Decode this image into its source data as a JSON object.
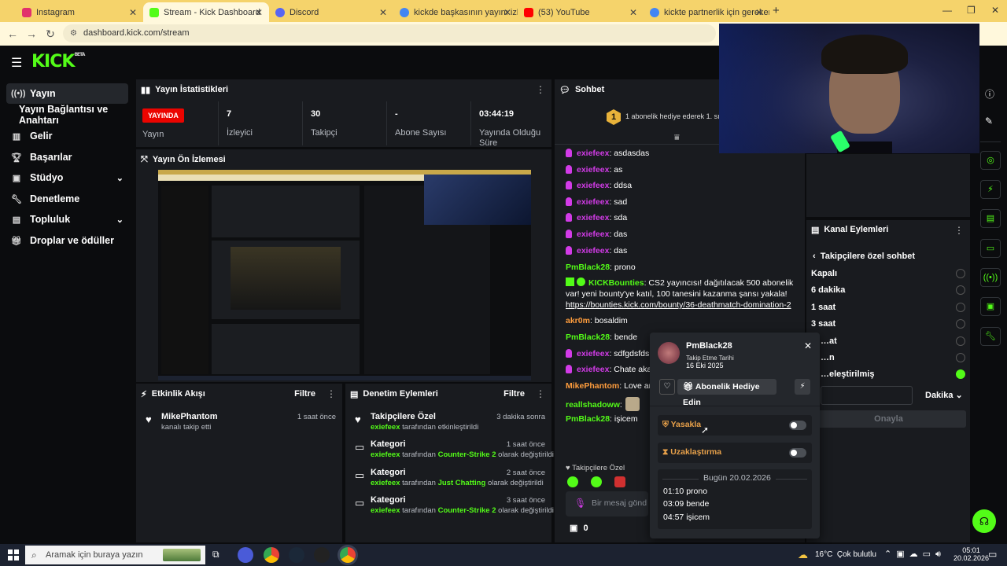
{
  "browser": {
    "tabs": [
      {
        "label": "Instagram",
        "color": "#e1306c"
      },
      {
        "label": "Stream - Kick Dashboard",
        "color": "#53fc18"
      },
      {
        "label": "Discord",
        "color": "#5865f2"
      },
      {
        "label": "kickde başkasının yayını izleme",
        "color": "#4285f4"
      },
      {
        "label": "(53) YouTube",
        "color": "#ff0000"
      },
      {
        "label": "kickte partnerlik için gerekenle",
        "color": "#4285f4"
      }
    ],
    "new_tab": "+",
    "url": "dashboard.kick.com/stream"
  },
  "header": {
    "logo": "KICK",
    "beta": "BETA"
  },
  "sidebar": {
    "items": [
      {
        "label": "Yayın",
        "icon": "broadcast-icon"
      },
      {
        "label": "Yayın Bağlantısı ve Anahtarı",
        "icon": ""
      },
      {
        "label": "Gelir",
        "icon": "chart-icon"
      },
      {
        "label": "Başarılar",
        "icon": "trophy-icon"
      },
      {
        "label": "Stüdyo",
        "icon": "studio-icon"
      },
      {
        "label": "Denetleme",
        "icon": "wrench-icon"
      },
      {
        "label": "Topluluk",
        "icon": "community-icon"
      },
      {
        "label": "Droplar ve ödüller",
        "icon": "gift-icon"
      }
    ]
  },
  "stats": {
    "title": "Yayın İstatistikleri",
    "live_badge": "YAYINDA",
    "live_label": "Yayın",
    "viewers_value": "7",
    "viewers_label": "İzleyici",
    "followers_value": "30",
    "followers_label": "Takipçi",
    "subs_value": "-",
    "subs_label": "Abone Sayısı",
    "uptime_value": "03:44:19",
    "uptime_label1": "Yayında Olduğu",
    "uptime_label2": "Süre"
  },
  "preview": {
    "title": "Yayın Ön İzlemesi"
  },
  "activity": {
    "title": "Etkinlik Akışı",
    "filter": "Filtre",
    "items": [
      {
        "name": "MikePhantom",
        "desc": "kanalı takip etti",
        "time": "1 saat önce"
      }
    ]
  },
  "moderation": {
    "title": "Denetim Eylemleri",
    "filter": "Filtre",
    "items": [
      {
        "title": "Takipçilere Özel",
        "user": "exiefeex",
        "pre": "tarafından etkinleştirildi",
        "target": "",
        "post": "",
        "time": "3 dakika sonra"
      },
      {
        "title": "Kategori",
        "user": "exiefeex",
        "pre": "tarafından",
        "target": "Counter-Strike 2",
        "post": "olarak değiştirildi",
        "time": "1 saat önce"
      },
      {
        "title": "Kategori",
        "user": "exiefeex",
        "pre": "tarafından",
        "target": "Just Chatting",
        "post": "olarak değiştirildi",
        "time": "2 saat önce"
      },
      {
        "title": "Kategori",
        "user": "exiefeex",
        "pre": "tarafından",
        "target": "Counter-Strike 2",
        "post": "olarak değiştirildi",
        "time": "3 saat önce"
      }
    ]
  },
  "chat": {
    "title": "Sohbet",
    "gift_rank": "1",
    "gift_text": "1 abonelik hediye ederek 1. sıra",
    "messages": [
      {
        "user": "exiefeex",
        "text": ": asdasdas",
        "color": "#d23be7",
        "badge": true
      },
      {
        "user": "exiefeex",
        "text": ": as",
        "color": "#d23be7",
        "badge": true
      },
      {
        "user": "exiefeex",
        "text": ": ddsa",
        "color": "#d23be7",
        "badge": true
      },
      {
        "user": "exiefeex",
        "text": ": sad",
        "color": "#d23be7",
        "badge": true
      },
      {
        "user": "exiefeex",
        "text": ": sda",
        "color": "#d23be7",
        "badge": true
      },
      {
        "user": "exiefeex",
        "text": ": das",
        "color": "#d23be7",
        "badge": true
      },
      {
        "user": "exiefeex",
        "text": ": das",
        "color": "#d23be7",
        "badge": true
      },
      {
        "user": "PmBlack28",
        "text": ": prono",
        "color": "#53fc18",
        "badge": false
      }
    ],
    "bounty_user": "KICKBounties",
    "bounty_text": ": CS2 yayıncısı! dağıtılacak 500 abonelik var! yeni bounty'ye katıl, 100 tanesini kazanma şansı yakala!",
    "bounty_link": "https://bounties.kick.com/bounty/36-deathmatch-domination-2",
    "messages2": [
      {
        "user": "akr0m",
        "text": ": bosaldim",
        "color": "#ff9d3d",
        "badge": false
      },
      {
        "user": "PmBlack28",
        "text": ": bende",
        "color": "#53fc18",
        "badge": false
      },
      {
        "user": "exiefeex",
        "text": ": sdfgdsfds",
        "color": "#d23be7",
        "badge": true
      },
      {
        "user": "exiefeex",
        "text": ": Chate aka",
        "color": "#d23be7",
        "badge": true
      },
      {
        "user": "MikePhantom",
        "text": ": Love and",
        "color": "#ff9d3d",
        "badge": false
      },
      {
        "user": "reallshadoww",
        "text": ":",
        "color": "#53fc18",
        "badge": false
      },
      {
        "user": "PmBlack28",
        "text": ": işicem",
        "color": "#53fc18",
        "badge": false
      }
    ],
    "mode": "Takipçilere Özel",
    "input_placeholder": "Bir mesaj gönd",
    "points": "0"
  },
  "channel_actions": {
    "title": "Kanal Eylemleri",
    "back_label": "Takipçilere özel sohbet",
    "options": [
      "Kapalı",
      "6 dakika",
      "1 saat",
      "3 saat",
      "…at",
      "…n",
      "…eleştirilmiş"
    ],
    "unit": "Dakika",
    "confirm": "Onayla"
  },
  "user_card": {
    "username": "PmBlack28",
    "follow_label": "Takip Etme Tarihi",
    "follow_date": "16 Eki 2025",
    "gift_button": "Abonelik Hediye Edin",
    "ban_label": "Yasakla",
    "timeout_label": "Uzaklaştırma",
    "date_divider": "Bugün 20.02.2026",
    "history": [
      "01:10 prono",
      "03:09 bende",
      "04:57 işicem"
    ]
  },
  "taskbar": {
    "search_placeholder": "Aramak için buraya yazın",
    "weather": "16°C  Çok bulutlu",
    "time": "05:01",
    "date": "20.02.2026"
  }
}
